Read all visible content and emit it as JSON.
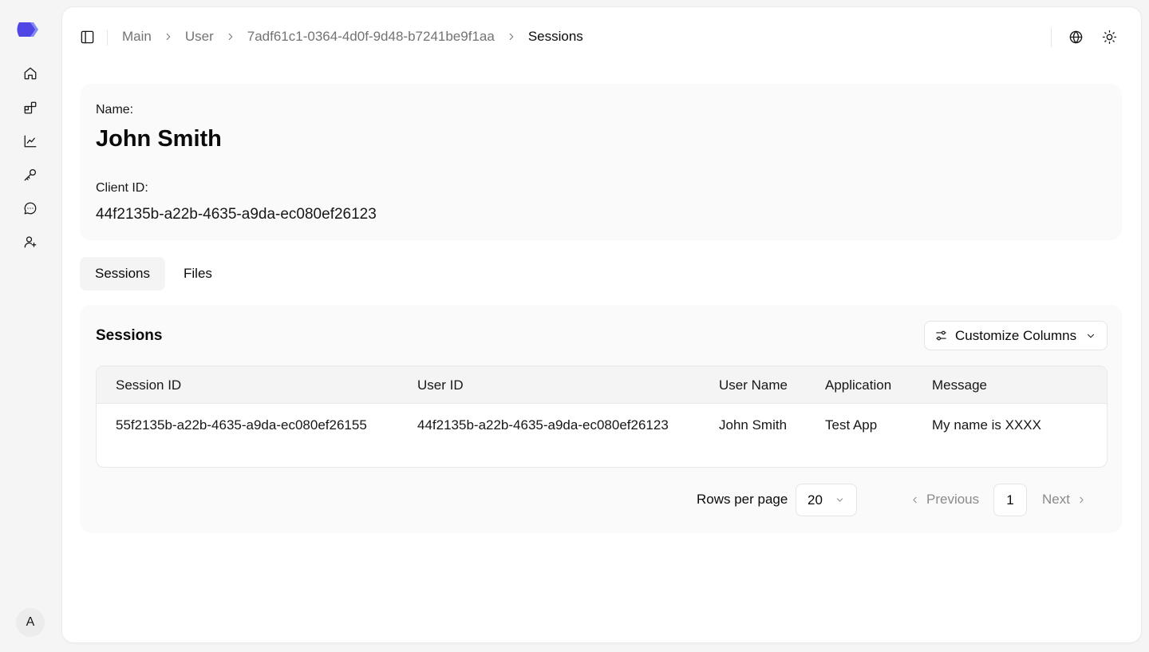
{
  "sidebar": {
    "items": [
      {
        "name": "home",
        "icon": "home-icon"
      },
      {
        "name": "apps",
        "icon": "grid-icon"
      },
      {
        "name": "analytics",
        "icon": "chart-line-icon"
      },
      {
        "name": "keys",
        "icon": "key-icon"
      },
      {
        "name": "messages",
        "icon": "message-icon"
      },
      {
        "name": "add-user",
        "icon": "user-plus-icon"
      }
    ],
    "avatar_initial": "A",
    "brand_color": "#4f46e5"
  },
  "breadcrumb": [
    "Main",
    "User",
    "7adf61c1-0364-4d0f-9d48-b7241be9f1aa",
    "Sessions"
  ],
  "user": {
    "name_label": "Name:",
    "name": "John Smith",
    "client_id_label": "Client ID:",
    "client_id": "44f2135b-a22b-4635-a9da-ec080ef26123"
  },
  "tabs": [
    {
      "label": "Sessions",
      "active": true
    },
    {
      "label": "Files",
      "active": false
    }
  ],
  "sessions": {
    "title": "Sessions",
    "customize_label": "Customize Columns",
    "columns": [
      "Session ID",
      "User ID",
      "User Name",
      "Application",
      "Message"
    ],
    "rows": [
      [
        "55f2135b-a22b-4635-a9da-ec080ef26155",
        "44f2135b-a22b-4635-a9da-ec080ef26123",
        "John Smith",
        "Test App",
        "My name is XXXX"
      ]
    ]
  },
  "pagination": {
    "rows_per_page_label": "Rows per page",
    "rows_per_page": "20",
    "previous_label": "Previous",
    "current_page": "1",
    "next_label": "Next"
  }
}
